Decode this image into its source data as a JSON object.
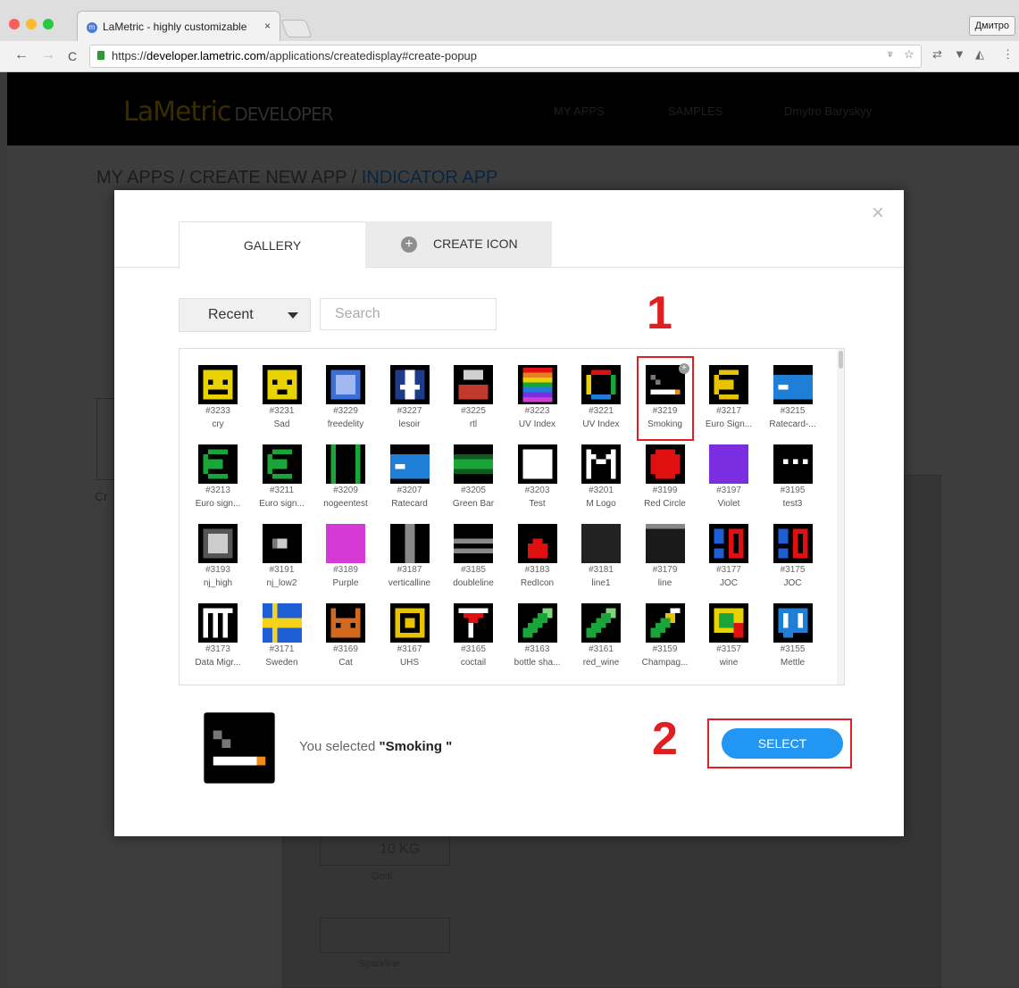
{
  "browser": {
    "tab_title": "LaMetric - highly customizable",
    "tab_close": "×",
    "favicon_letter": "m",
    "profile": "Дмитро",
    "url_scheme": "https://",
    "url_host": "developer.lametric.com",
    "url_path": "/applications/createdisplay#create-popup",
    "nav_back": "←",
    "nav_forward": "→",
    "nav_reload": "C",
    "toolbar_icons": [
      "♆",
      "☆",
      "⇄",
      "▼",
      "◭",
      "⋮"
    ]
  },
  "site": {
    "logo_text": "LaMetric",
    "logo_dev": "DEVELOPER",
    "nav": [
      "MY APPS",
      "SAMPLES",
      "Dmytro Baryskyy"
    ],
    "breadcrumb": "MY APPS / CREATE NEW APP / ",
    "breadcrumb_current": "INDICATOR APP",
    "bg_label_cr": "Cr",
    "bg_weight": "10 KG",
    "bg_goal": "Goal",
    "bg_sparkline": "Sparkline"
  },
  "modal": {
    "close": "×",
    "tabs": [
      "GALLERY",
      "CREATE ICON"
    ],
    "plus": "+",
    "filter": "Recent",
    "search_placeholder": "Search",
    "icons": [
      {
        "num": "#3233",
        "name": "cry",
        "kind": "smiley",
        "color": "#e8d200"
      },
      {
        "num": "#3231",
        "name": "Sad",
        "kind": "sad",
        "color": "#e8d200"
      },
      {
        "num": "#3229",
        "name": "freedelity",
        "kind": "square",
        "color": "#3a6fd8"
      },
      {
        "num": "#3227",
        "name": "lesoir",
        "kind": "letter",
        "color": "#1e3a8a"
      },
      {
        "num": "#3225",
        "name": "rtl",
        "kind": "stack",
        "color": "#c0392b"
      },
      {
        "num": "#3223",
        "name": "UV Index",
        "kind": "rainbow",
        "color": "#e67e22"
      },
      {
        "num": "#3221",
        "name": "UV Index",
        "kind": "ring",
        "color": "#27ae60"
      },
      {
        "num": "#3219",
        "name": "Smoking",
        "kind": "smoking",
        "color": "#ffffff"
      },
      {
        "num": "#3217",
        "name": "Euro Sign...",
        "kind": "euro",
        "color": "#e8c300"
      },
      {
        "num": "#3215",
        "name": "Ratecard-...",
        "kind": "card",
        "color": "#1f7fd6"
      },
      {
        "num": "#3213",
        "name": "Euro sign...",
        "kind": "euro",
        "color": "#1aa53a"
      },
      {
        "num": "#3211",
        "name": "Euro sign...",
        "kind": "euro",
        "color": "#1aa53a"
      },
      {
        "num": "#3209",
        "name": "nogeentest",
        "kind": "bars",
        "color": "#1aa53a"
      },
      {
        "num": "#3207",
        "name": "Ratecard",
        "kind": "card",
        "color": "#1f7fd6"
      },
      {
        "num": "#3205",
        "name": "Green Bar",
        "kind": "greenbar",
        "color": "#1aa53a"
      },
      {
        "num": "#3203",
        "name": "Test",
        "kind": "letter",
        "color": "#ffffff"
      },
      {
        "num": "#3201",
        "name": "M Logo",
        "kind": "mlogo",
        "color": "#ffffff"
      },
      {
        "num": "#3199",
        "name": "Red Circle",
        "kind": "circle",
        "color": "#e01010"
      },
      {
        "num": "#3197",
        "name": "Violet",
        "kind": "fill",
        "color": "#7a2ee0"
      },
      {
        "num": "#3195",
        "name": "test3",
        "kind": "dots",
        "color": "#ffffff"
      },
      {
        "num": "#3193",
        "name": "nj_high",
        "kind": "frame",
        "color": "#cccccc"
      },
      {
        "num": "#3191",
        "name": "nj_low2",
        "kind": "dot",
        "color": "#cccccc"
      },
      {
        "num": "#3189",
        "name": "Purple",
        "kind": "fill",
        "color": "#d63ad6"
      },
      {
        "num": "#3187",
        "name": "verticalline",
        "kind": "vline",
        "color": "#888888"
      },
      {
        "num": "#3185",
        "name": "doubleline",
        "kind": "hlines",
        "color": "#888888"
      },
      {
        "num": "#3183",
        "name": "RedIcon",
        "kind": "redtri",
        "color": "#e01010"
      },
      {
        "num": "#3181",
        "name": "line1",
        "kind": "blank",
        "color": "#222222"
      },
      {
        "num": "#3179",
        "name": "line",
        "kind": "topline",
        "color": "#888888"
      },
      {
        "num": "#3177",
        "name": "JOC",
        "kind": "joc",
        "color": "#1f5fd6"
      },
      {
        "num": "#3175",
        "name": "JOC",
        "kind": "joc",
        "color": "#1f5fd6"
      },
      {
        "num": "#3173",
        "name": "Data Migr...",
        "kind": "datamig",
        "color": "#ffffff"
      },
      {
        "num": "#3171",
        "name": "Sweden",
        "kind": "sweden",
        "color": "#1f5fd6"
      },
      {
        "num": "#3169",
        "name": "Cat",
        "kind": "cat",
        "color": "#d2691e"
      },
      {
        "num": "#3167",
        "name": "UHS",
        "kind": "uhs",
        "color": "#e8c300"
      },
      {
        "num": "#3165",
        "name": "coctail",
        "kind": "cocktail",
        "color": "#e01010"
      },
      {
        "num": "#3163",
        "name": "bottle sha...",
        "kind": "bottle",
        "color": "#1aa53a"
      },
      {
        "num": "#3161",
        "name": "red_wine",
        "kind": "bottle",
        "color": "#1aa53a"
      },
      {
        "num": "#3159",
        "name": "Champag...",
        "kind": "champ",
        "color": "#e8c300"
      },
      {
        "num": "#3157",
        "name": "wine",
        "kind": "wine",
        "color": "#e8c300"
      },
      {
        "num": "#3155",
        "name": "Mettle",
        "kind": "mettle",
        "color": "#1f7fd6"
      }
    ],
    "selected_prefix": "You selected ",
    "selected_name": "\"Smoking \"",
    "select_button": "SELECT",
    "marker_1": "1",
    "marker_2": "2"
  }
}
